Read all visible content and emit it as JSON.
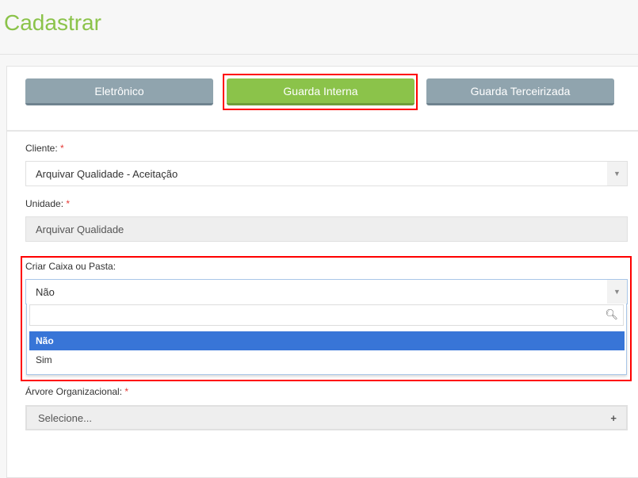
{
  "page": {
    "title": "Cadastrar"
  },
  "tabs": [
    {
      "label": "Eletrônico"
    },
    {
      "label": "Guarda Interna"
    },
    {
      "label": "Guarda Terceirizada"
    }
  ],
  "form": {
    "cliente": {
      "label": "Cliente:",
      "required": "*",
      "value": "Arquivar Qualidade - Aceitação"
    },
    "unidade": {
      "label": "Unidade:",
      "required": "*",
      "value": "Arquivar Qualidade"
    },
    "criar": {
      "label": "Criar Caixa ou Pasta:",
      "value": "Não",
      "options": [
        "Não",
        "Sim"
      ]
    },
    "arvore": {
      "label": "Árvore Organizacional:",
      "required": "*",
      "placeholder": "Selecione...",
      "icon": "+"
    }
  },
  "colors": {
    "accent": "#8bc34a",
    "tab": "#90a4ae",
    "highlight": "#3875d7",
    "annotation": "#ff0000"
  }
}
